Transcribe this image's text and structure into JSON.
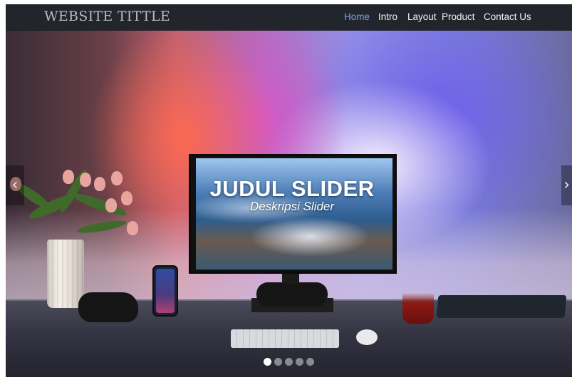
{
  "site": {
    "title": "WEBSITE TITTLE"
  },
  "nav": {
    "items": [
      {
        "label": "Home",
        "active": true
      },
      {
        "label": "Intro",
        "active": false
      },
      {
        "label": "Layout",
        "active": false
      },
      {
        "label": "Product",
        "active": false
      },
      {
        "label": "Contact Us",
        "active": false
      }
    ],
    "active_color": "#7ea3e0"
  },
  "carousel": {
    "slide_title": "JUDUL SLIDER",
    "slide_description": "Deskripsi Slider",
    "prev_icon": "chevron-left-icon",
    "next_icon": "chevron-right-icon",
    "prev_glyph": "‹",
    "next_glyph": "›",
    "slide_count": 5,
    "active_index": 0
  }
}
